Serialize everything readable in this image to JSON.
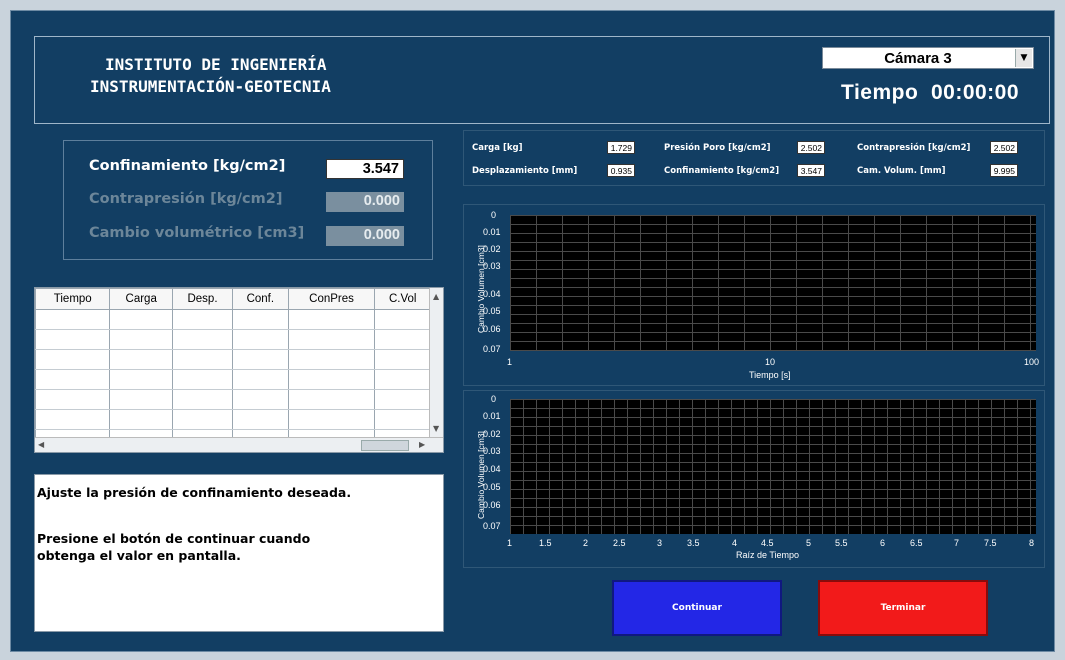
{
  "header": {
    "title_line1": "INSTITUTO DE INGENIERÍA",
    "title_line2": "INSTRUMENTACIÓN-GEOTECNIA",
    "camera_selected": "Cámara 3",
    "tiempo_label": "Tiempo",
    "tiempo_value": "00:00:00"
  },
  "controls": {
    "confinamiento_label": "Confinamiento [kg/cm2]",
    "confinamiento_value": "3.547",
    "contrapresion_label": "Contrapresión [kg/cm2]",
    "contrapresion_value": "0.000",
    "cambio_label": "Cambio volumétrico [cm3]",
    "cambio_value": "0.000"
  },
  "table": {
    "columns": [
      "Tiempo",
      "Carga",
      "Desp.",
      "Conf.",
      "ConPres",
      "C.Vol"
    ]
  },
  "message": {
    "line1": "Ajuste la presión de  confinamiento deseada.",
    "line2": "Presione el botón de continuar cuando",
    "line3": "obtenga el valor en pantalla."
  },
  "indicators": {
    "carga_label": "Carga [kg]",
    "carga_value": "1.729",
    "presion_poro_label": "Presión Poro [kg/cm2]",
    "presion_poro_value": "2.502",
    "contrapresion_label": "Contrapresión [kg/cm2]",
    "contrapresion_value": "2.502",
    "desplazamiento_label": "Desplazamiento [mm]",
    "desplazamiento_value": "0.935",
    "confinamiento_label": "Confinamiento [kg/cm2]",
    "confinamiento_value": "3.547",
    "cam_volum_label": "Cam. Volum. [mm]",
    "cam_volum_value": "9.995"
  },
  "graph1": {
    "ylabel": "Cambio Volumen [cm3]",
    "xlabel": "Tiempo [s]",
    "yticks": [
      "0",
      "0.01",
      "0.02",
      "0.03",
      "0.04",
      "0.05",
      "0.06",
      "0.07"
    ],
    "xticks": [
      "1",
      "10",
      "100"
    ]
  },
  "graph2": {
    "ylabel": "Cambio Volumen [cm3]",
    "xlabel": "Raíz de Tiempo",
    "yticks": [
      "0",
      "0.01",
      "0.02",
      "0.03",
      "0.04",
      "0.05",
      "0.06",
      "0.07"
    ],
    "xticks": [
      "1",
      "1.5",
      "2",
      "2.5",
      "3",
      "3.5",
      "4",
      "4.5",
      "5",
      "5.5",
      "6",
      "6.5",
      "7",
      "7.5",
      "8"
    ]
  },
  "buttons": {
    "continuar": "Continuar",
    "terminar": "Terminar"
  },
  "colors": {
    "panel_bg": "#123e63",
    "continuar_btn": "#2327e6",
    "terminar_btn": "#f21a1a"
  }
}
